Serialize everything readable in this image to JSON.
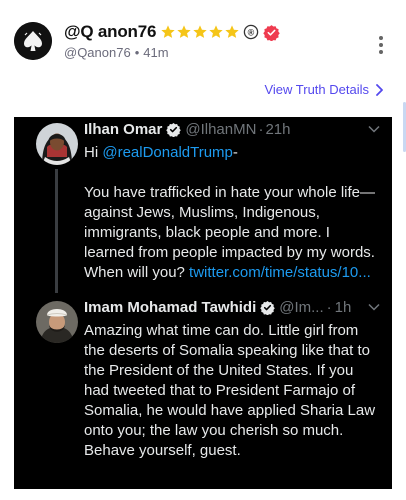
{
  "post": {
    "display_name": "@Q anon76",
    "handle": "@Qanon76",
    "dot": "•",
    "time": "41m",
    "badges": {
      "stars": 5,
      "star_color": "#f5c518",
      "registered_mark": "®",
      "verified_color": "#ef3b4f"
    }
  },
  "actions": {
    "view_details": "View Truth Details"
  },
  "embed": {
    "tweet1": {
      "name": "Ilhan Omar",
      "handle": "@IlhanMN",
      "dot": "·",
      "time": "21h",
      "mention": "@realDonaldTrump",
      "greeting": "Hi ",
      "greeting_suffix": "-",
      "body": "You have trafficked in hate your whole life—against Jews, Muslims, Indigenous, immigrants, black people and more. I learned from people impacted by my words. When will you? ",
      "link": "twitter.com/time/status/10..."
    },
    "tweet2": {
      "name": "Imam Mohamad Tawhidi",
      "handle": "@Im...",
      "dot": "·",
      "time": "1h",
      "body": "Amazing what time can do. Little girl from the deserts of Somalia speaking like that to the President of the United States. If you had tweeted that to President Farmajo of Somalia, he would have applied Sharia Law onto you; the law you cherish so much. Behave yourself, guest."
    },
    "colors": {
      "background": "#000000",
      "text": "#e7e9ea",
      "muted": "#71767b",
      "link": "#1d9bf0"
    }
  }
}
